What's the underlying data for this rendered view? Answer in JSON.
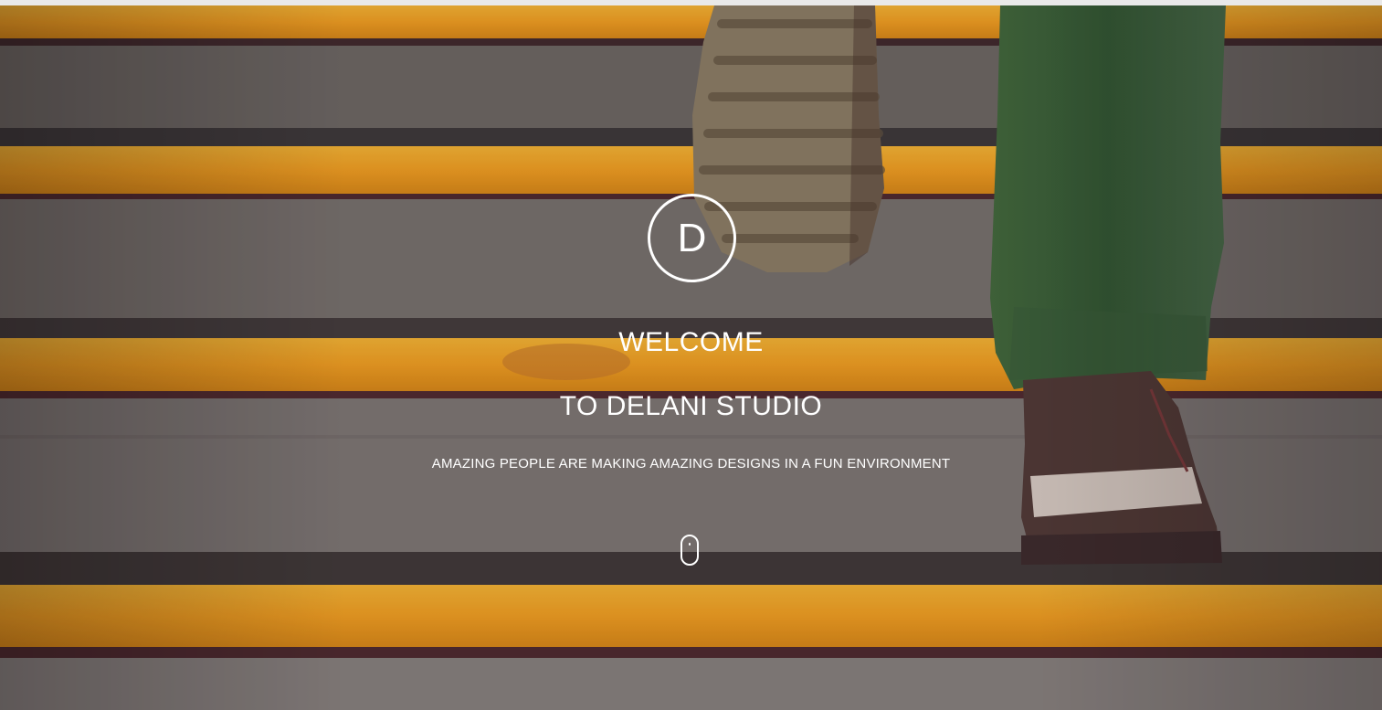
{
  "hero": {
    "logo_letter": "D",
    "welcome": "WELCOME",
    "studio": "TO DELANI STUDIO",
    "tagline": "AMAZING PEOPLE ARE MAKING AMAZING DESIGNS IN A FUN ENVIRONMENT",
    "scroll_icon": "mouse-scroll-icon"
  },
  "colors": {
    "stair_yellow": "#f2a51f",
    "concrete": "#6e6d68",
    "text": "#ffffff"
  }
}
